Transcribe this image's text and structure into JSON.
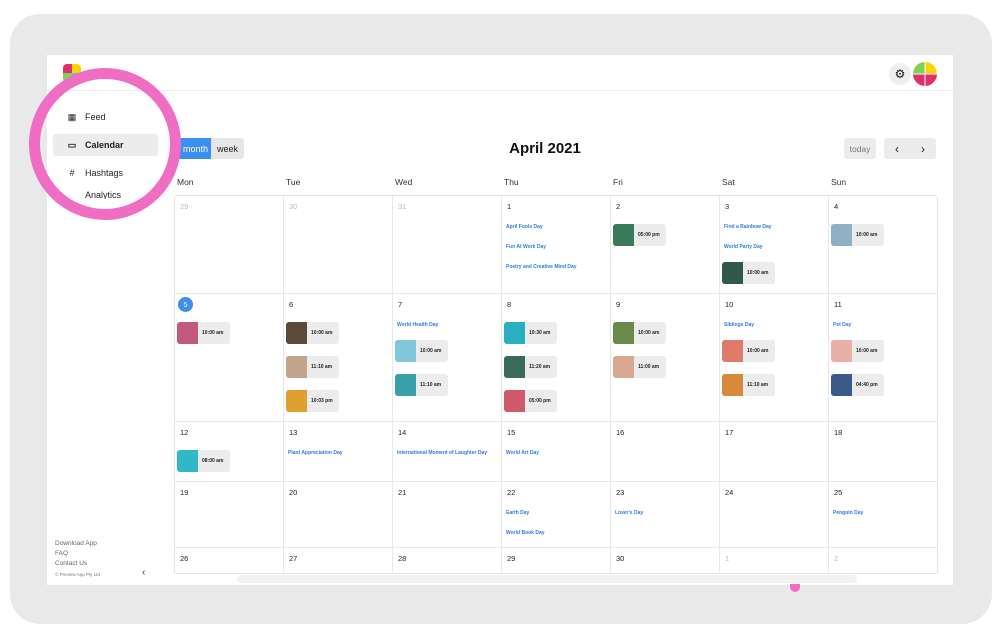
{
  "app": {
    "logo_text": ""
  },
  "sidebar": {
    "items": [
      {
        "label": "Feed",
        "icon": "grid-icon",
        "active": false
      },
      {
        "label": "Calendar",
        "icon": "calendar-icon",
        "active": true
      },
      {
        "label": "Hashtags",
        "icon": "hashtag-icon",
        "active": false
      },
      {
        "label": "Analytics",
        "icon": "analytics-icon",
        "active": false
      }
    ],
    "footer_links": [
      "Download App",
      "FAQ",
      "Contact Us"
    ],
    "copyright": "© Preview App Pty Ltd",
    "collapse_icon": "chevron-left-icon"
  },
  "toolbar": {
    "view_month": "month",
    "view_week": "week",
    "title": "April 2021",
    "today": "today",
    "prev": "‹",
    "next": "›"
  },
  "colors": {
    "accent": "#3b8ff0",
    "highlight_ring": "#ef6ec4",
    "event_text": "#2a7de1"
  },
  "weekdays": [
    "Mon",
    "Tue",
    "Wed",
    "Thu",
    "Fri",
    "Sat",
    "Sun"
  ],
  "weeks": [
    [
      {
        "day": "29",
        "other": true,
        "events": [],
        "posts": []
      },
      {
        "day": "30",
        "other": true,
        "events": [],
        "posts": []
      },
      {
        "day": "31",
        "other": true,
        "events": [],
        "posts": []
      },
      {
        "day": "1",
        "events": [
          "April Fools Day",
          "Fun At Work Day",
          "Poetry and Creative Mind Day"
        ],
        "posts": []
      },
      {
        "day": "2",
        "events": [],
        "posts": [
          {
            "time": "05:00 pm",
            "color": "#3a7a5c"
          }
        ]
      },
      {
        "day": "3",
        "events": [
          "Find a Rainbow Day",
          "World Party Day"
        ],
        "posts": [
          {
            "time": "10:00 am",
            "color": "#2f5a4a"
          }
        ]
      },
      {
        "day": "4",
        "events": [],
        "posts": [
          {
            "time": "10:00 am",
            "color": "#8fb0c4"
          }
        ]
      }
    ],
    [
      {
        "day": "5",
        "today": true,
        "events": [],
        "posts": [
          {
            "time": "10:00 am",
            "color": "#c0597a"
          }
        ]
      },
      {
        "day": "6",
        "events": [],
        "posts": [
          {
            "time": "10:00 am",
            "color": "#5a4a3a"
          },
          {
            "time": "11:10 am",
            "color": "#c2a58a"
          },
          {
            "time": "10:03 pm",
            "color": "#e0a030"
          }
        ]
      },
      {
        "day": "7",
        "events": [
          "World Health Day"
        ],
        "posts": [
          {
            "time": "10:00 am",
            "color": "#7fc7d9"
          },
          {
            "time": "11:10 am",
            "color": "#3aa0a8"
          }
        ]
      },
      {
        "day": "8",
        "events": [],
        "posts": [
          {
            "time": "10:30 am",
            "color": "#28b0c0"
          },
          {
            "time": "11:20 am",
            "color": "#3a6a5a"
          },
          {
            "time": "05:00 pm",
            "color": "#d05a6a"
          }
        ]
      },
      {
        "day": "9",
        "events": [],
        "posts": [
          {
            "time": "10:00 am",
            "color": "#6a8a4a"
          },
          {
            "time": "11:00 am",
            "color": "#d8a890"
          }
        ]
      },
      {
        "day": "10",
        "events": [
          "Siblings Day"
        ],
        "posts": [
          {
            "time": "10:00 am",
            "color": "#e07a6a"
          },
          {
            "time": "11:10 am",
            "color": "#d88a3a"
          }
        ]
      },
      {
        "day": "11",
        "events": [
          "Pet Day"
        ],
        "posts": [
          {
            "time": "10:00 am",
            "color": "#e8b0a8"
          },
          {
            "time": "04:40 pm",
            "color": "#3a5a8a"
          }
        ]
      }
    ],
    [
      {
        "day": "12",
        "events": [],
        "posts": [
          {
            "time": "08:00 am",
            "color": "#30b8c8"
          }
        ]
      },
      {
        "day": "13",
        "events": [
          "Plant Appreciation Day"
        ],
        "posts": []
      },
      {
        "day": "14",
        "events": [
          "International Moment of Laughter Day"
        ],
        "posts": []
      },
      {
        "day": "15",
        "events": [
          "World Art Day"
        ],
        "posts": []
      },
      {
        "day": "16",
        "events": [],
        "posts": []
      },
      {
        "day": "17",
        "events": [],
        "posts": []
      },
      {
        "day": "18",
        "events": [],
        "posts": []
      }
    ],
    [
      {
        "day": "19",
        "events": [],
        "posts": []
      },
      {
        "day": "20",
        "events": [],
        "posts": []
      },
      {
        "day": "21",
        "events": [],
        "posts": []
      },
      {
        "day": "22",
        "events": [
          "Earth Day",
          "World Book Day"
        ],
        "posts": []
      },
      {
        "day": "23",
        "events": [
          "Lover's Day"
        ],
        "posts": []
      },
      {
        "day": "24",
        "events": [],
        "posts": []
      },
      {
        "day": "25",
        "events": [
          "Penguin Day"
        ],
        "posts": []
      }
    ],
    [
      {
        "day": "26",
        "events": [],
        "posts": []
      },
      {
        "day": "27",
        "events": [],
        "posts": []
      },
      {
        "day": "28",
        "events": [],
        "posts": []
      },
      {
        "day": "29",
        "events": [],
        "posts": []
      },
      {
        "day": "30",
        "events": [],
        "posts": []
      },
      {
        "day": "1",
        "other": true,
        "events": [],
        "posts": []
      },
      {
        "day": "2",
        "other": true,
        "events": [],
        "posts": []
      }
    ]
  ]
}
